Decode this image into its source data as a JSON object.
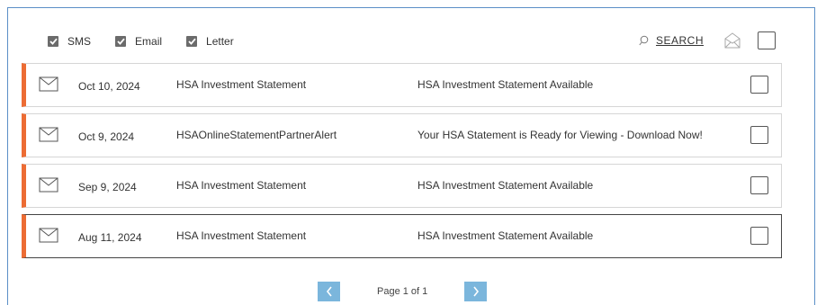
{
  "filters": [
    {
      "label": "SMS",
      "checked": true
    },
    {
      "label": "Email",
      "checked": true
    },
    {
      "label": "Letter",
      "checked": true
    }
  ],
  "toolbar": {
    "search_label": "SEARCH",
    "search_icon": "magnifier-icon",
    "open_mail_icon": "open-envelope-icon"
  },
  "messages": [
    {
      "date": "Oct 10, 2024",
      "type": "HSA Investment Statement",
      "description": "HSA Investment Statement Available",
      "selected": false
    },
    {
      "date": "Oct 9, 2024",
      "type": "HSAOnlineStatementPartnerAlert",
      "description": "Your HSA Statement is Ready for Viewing - Download Now!",
      "selected": false
    },
    {
      "date": "Sep 9, 2024",
      "type": "HSA Investment Statement",
      "description": "HSA Investment Statement Available",
      "selected": false
    },
    {
      "date": "Aug 11, 2024",
      "type": "HSA Investment Statement",
      "description": "HSA Investment Statement Available",
      "selected": true
    }
  ],
  "pagination": {
    "info": "Page 1 of 1",
    "prev_icon": "chevron-left-icon",
    "next_icon": "chevron-right-icon"
  },
  "colors": {
    "accent_stripe": "#ec6c34",
    "pager_button": "#7bb6dc",
    "panel_border": "#5b8fc7"
  }
}
